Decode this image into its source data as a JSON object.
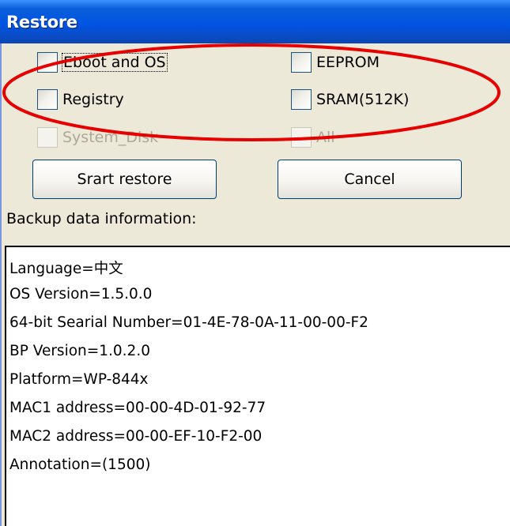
{
  "window": {
    "title": "Restore"
  },
  "restore_options": [
    {
      "label": "Eboot and OS",
      "checked": false,
      "enabled": true,
      "focused": true
    },
    {
      "label": "EEPROM",
      "checked": false,
      "enabled": true,
      "focused": false
    },
    {
      "label": "Registry",
      "checked": false,
      "enabled": true,
      "focused": false
    },
    {
      "label": "SRAM(512K)",
      "checked": false,
      "enabled": true,
      "focused": false
    },
    {
      "label": "System_Disk",
      "checked": false,
      "enabled": false,
      "focused": false
    },
    {
      "label": "All",
      "checked": false,
      "enabled": false,
      "focused": false
    }
  ],
  "buttons": {
    "start_label": "Srart restore",
    "cancel_label": "Cancel"
  },
  "backup_info": {
    "label": "Backup data information:",
    "lines": [
      "Language=中文",
      "OS Version=1.5.0.0",
      "64-bit Searial Number=01-4E-78-0A-11-00-00-F2",
      "BP Version=1.0.2.0",
      "Platform=WP-844x",
      "MAC1 address=00-00-4D-01-92-77",
      "MAC2 address=00-00-EF-10-F2-00",
      "Annotation=(1500)"
    ]
  },
  "colors": {
    "titlebar": "#0054E3",
    "window_bg": "#ECE9D8",
    "annotation_ellipse": "#E60000",
    "disabled_text": "#ACA899"
  }
}
